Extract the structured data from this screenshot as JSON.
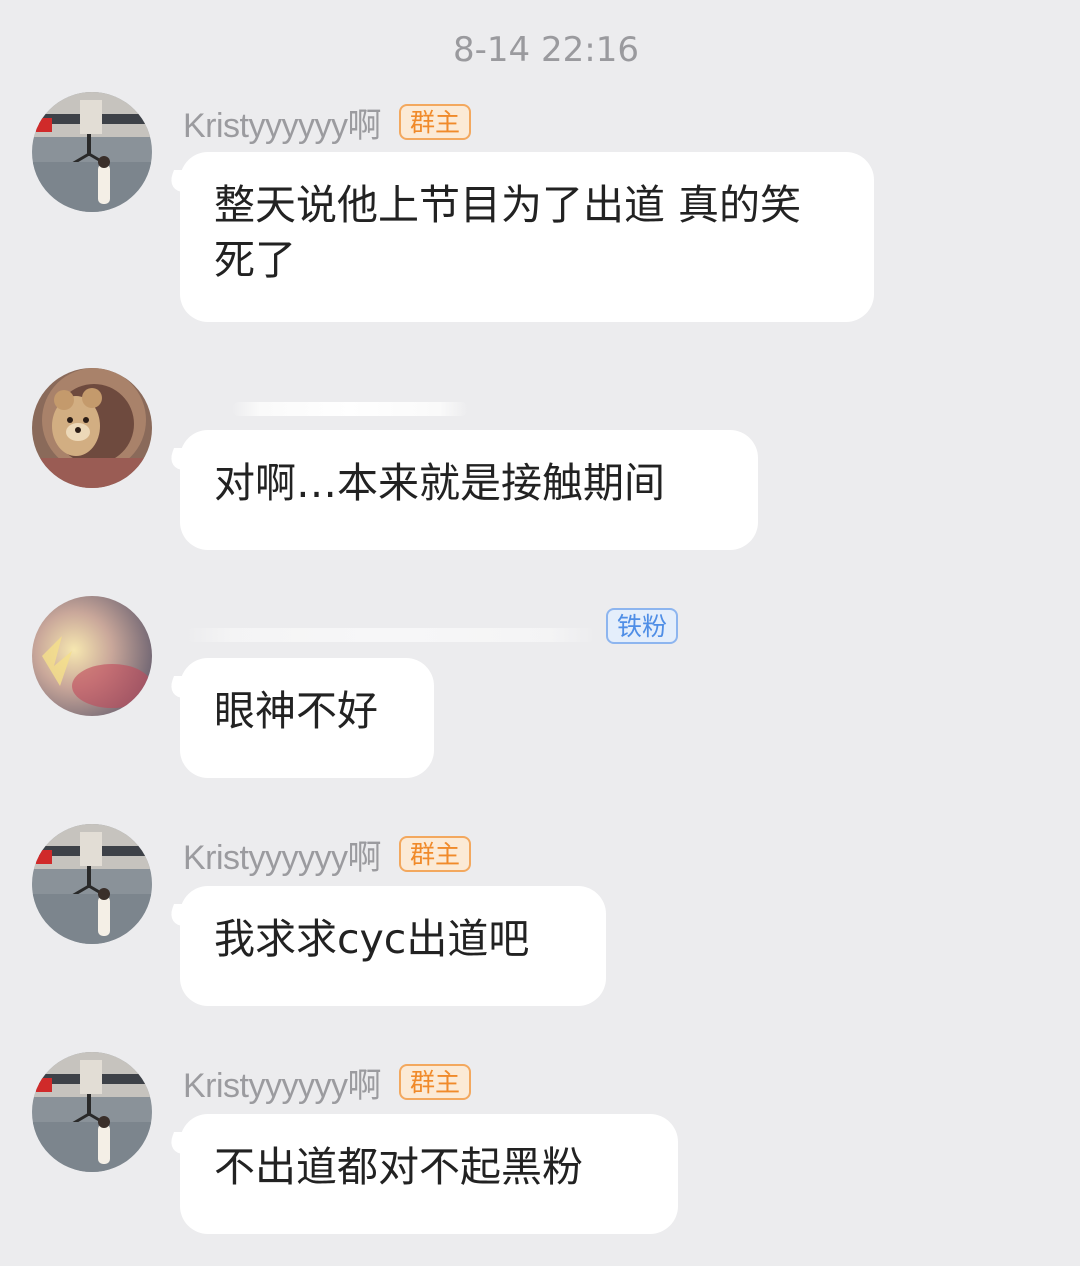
{
  "timestamp": "8-14 22:16",
  "messages": [
    {
      "sender": "Kristyyyyyy啊",
      "badge": "群主",
      "text": "整天说他上节目为了出道 真的笑死了",
      "avatar": "avatar-kristy"
    },
    {
      "sender": "",
      "badge": "",
      "text": "对啊…本来就是接触期间",
      "avatar": "avatar-bear"
    },
    {
      "sender": "",
      "badge": "铁粉",
      "text": "眼神不好",
      "avatar": "avatar-blurred"
    },
    {
      "sender": "Kristyyyyyy啊",
      "badge": "群主",
      "text": "我求求cyc出道吧",
      "avatar": "avatar-kristy"
    },
    {
      "sender": "Kristyyyyyy啊",
      "badge": "群主",
      "text": "不出道都对不起黑粉",
      "avatar": "avatar-kristy"
    }
  ],
  "colors": {
    "background": "#ececee",
    "bubble": "#ffffff",
    "owner_badge": "#f08a2a",
    "fan_badge": "#4f8ee6"
  }
}
